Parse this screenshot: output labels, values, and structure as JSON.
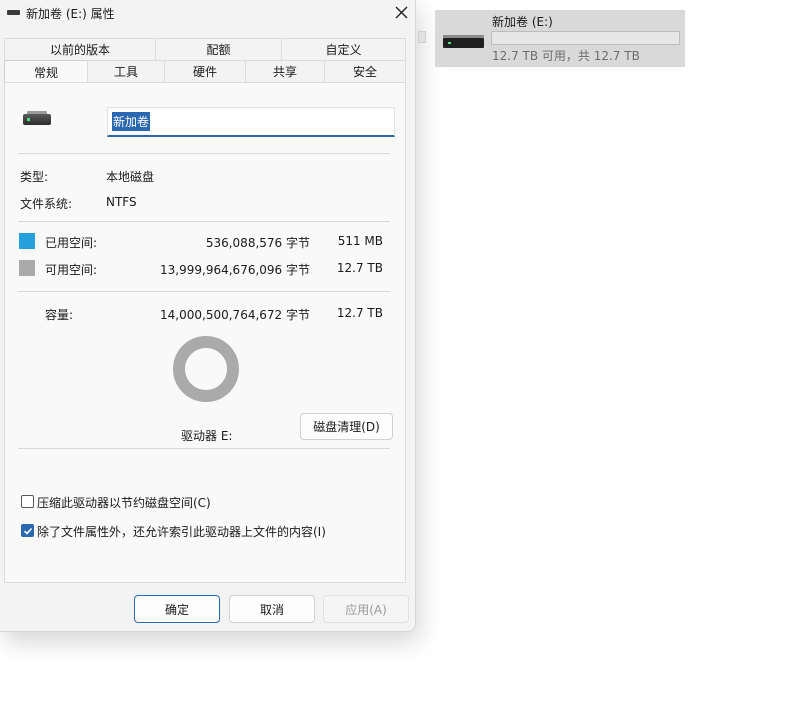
{
  "window": {
    "title": "新加卷 (E:) 属性",
    "close_icon": "close-icon"
  },
  "tabs_row1": [
    "以前的版本",
    "配额",
    "自定义"
  ],
  "tabs_row2": [
    "常规",
    "工具",
    "硬件",
    "共享",
    "安全"
  ],
  "active_tab": "常规",
  "general": {
    "volume_name": "新加卷",
    "type_label": "类型:",
    "type_value": "本地磁盘",
    "fs_label": "文件系统:",
    "fs_value": "NTFS",
    "used_label": "已用空间:",
    "used_bytes": "536,088,576 字节",
    "used_size": "511 MB",
    "free_label": "可用空间:",
    "free_bytes": "13,999,964,676,096 字节",
    "free_size": "12.7 TB",
    "capacity_label": "容量:",
    "capacity_bytes": "14,000,500,764,672 字节",
    "capacity_size": "12.7 TB",
    "drive_label": "驱动器 E:",
    "cleanup_button": "磁盘清理(D)",
    "compress_label": "压缩此驱动器以节约磁盘空间(C)",
    "compress_checked": false,
    "index_label": "除了文件属性外，还允许索引此驱动器上文件的内容(I)",
    "index_checked": true,
    "used_fraction": 3.83e-05
  },
  "buttons": {
    "ok": "确定",
    "cancel": "取消",
    "apply": "应用(A)"
  },
  "colors": {
    "used": "#26a0da",
    "free": "#aaaaaa",
    "accent": "#2b68b2"
  },
  "tile": {
    "name": "新加卷 (E:)",
    "subtitle": "12.7 TB 可用，共 12.7 TB",
    "used_fraction": 3.83e-05
  }
}
